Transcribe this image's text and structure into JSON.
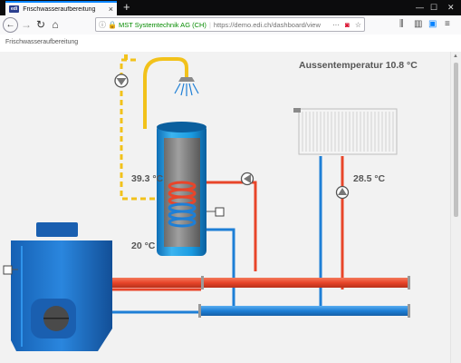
{
  "browser": {
    "tab_title": "Frischwasseraufbereitung",
    "favicon_text": "edi",
    "site_identity": "MST Systemtechnik AG (CH)",
    "url": "https://demo.edi.ch/dashboard/view"
  },
  "page": {
    "breadcrumb": "Frischwasseraufbereitung"
  },
  "schema": {
    "outside_temp": "Aussentemperatur 10.8 °C",
    "tank_top_temp": "39.3 °C",
    "tank_bottom_temp": "20 °C",
    "radiator_temp": "28.5 °C"
  },
  "colors": {
    "hot": "#e8452a",
    "cold": "#1e7fd6",
    "warm_water": "#f2c21b",
    "tank_blue": "#1a9be0",
    "boiler_blue": "#1a6fc9",
    "accent": "#0a84ff"
  },
  "icons": [
    "back-arrow-icon",
    "forward-arrow-icon",
    "reload-icon",
    "home-icon",
    "info-icon",
    "lock-icon",
    "menu-dots-icon",
    "pocket-icon",
    "star-icon",
    "library-icon",
    "sidebar-icon",
    "account-icon",
    "hamburger-menu-icon",
    "pump-icon",
    "shower-icon",
    "valve-icon",
    "sensor-icon"
  ]
}
